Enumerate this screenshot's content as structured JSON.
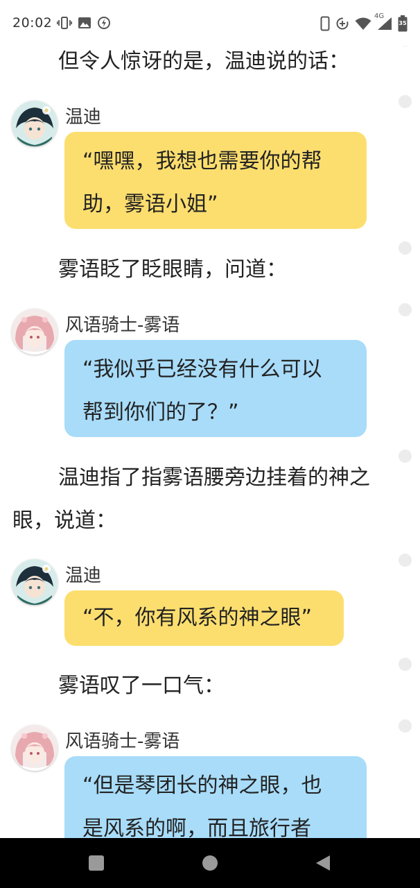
{
  "status_bar": {
    "time": "20:02",
    "network_label": "4G",
    "battery_level": "35",
    "icons": [
      "vibrate-icon",
      "image-icon",
      "sync-icon",
      "phone-icon",
      "data-saver-icon",
      "wifi-icon",
      "signal-icon",
      "battery-icon"
    ]
  },
  "story": {
    "narration_1": "但令人惊讶的是，温迪说的话：",
    "message_1": {
      "speaker": "温迪",
      "text": "“嘿嘿，我想也需要你的帮助，雾语小姐”",
      "line1": "“嘿嘿，我想也需要你的帮",
      "line2": "助，雾语小姐”",
      "color": "#fcde6f"
    },
    "narration_2": "雾语眨了眨眼睛，问道：",
    "message_2": {
      "speaker": "风语骑士-雾语",
      "line1": "“我似乎已经没有什么可以",
      "line2": "帮到你们的了？”",
      "color": "#a8dcf9"
    },
    "narration_3": "温迪指了指雾语腰旁边挂着的神之眼，说道：",
    "message_3": {
      "speaker": "温迪",
      "text": "“不，你有风系的神之眼”",
      "color": "#fcde6f"
    },
    "narration_4": "雾语叹了一口气：",
    "message_4": {
      "speaker": "风语骑士-雾语",
      "line1": "“但是琴团长的神之眼，也",
      "line2": "是风系的啊，而且旅行者",
      "color": "#a8dcf9"
    }
  },
  "nav_bar": {
    "buttons": [
      "recents-button",
      "home-button",
      "back-button"
    ]
  }
}
